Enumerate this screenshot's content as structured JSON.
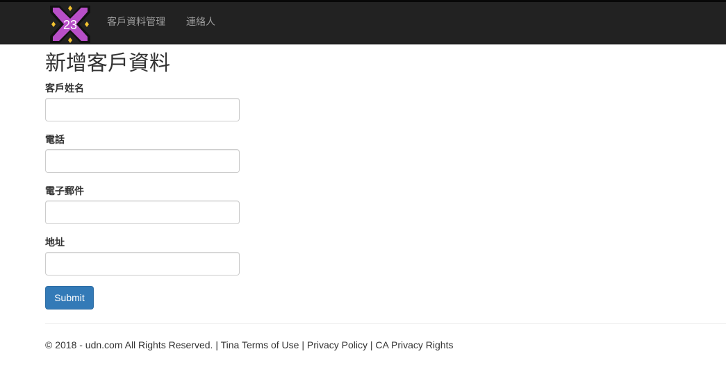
{
  "navbar": {
    "logo_text": "23",
    "links": [
      "客戶資料管理",
      "連絡人"
    ]
  },
  "page": {
    "title": "新增客戶資料"
  },
  "form": {
    "fields": [
      {
        "label": "客戶姓名",
        "value": "",
        "placeholder": ""
      },
      {
        "label": "電話",
        "value": "",
        "placeholder": ""
      },
      {
        "label": "電子郵件",
        "value": "",
        "placeholder": ""
      },
      {
        "label": "地址",
        "value": "",
        "placeholder": ""
      }
    ],
    "submit_label": "Submit"
  },
  "footer": {
    "copyright": "© 2018 - udn.com All Rights Reserved.",
    "sep1": " | ",
    "link_terms": "Tina Terms of Use",
    "sep2": " | ",
    "link_privacy": "Privacy Policy",
    "sep3": " | ",
    "link_ca": "CA Privacy Rights"
  },
  "colors": {
    "navbar_bg": "#222222",
    "nav_link": "#9d9d9d",
    "primary_button": "#337ab7",
    "logo_fill": "#b84fc8",
    "logo_accent": "#f2c230"
  }
}
